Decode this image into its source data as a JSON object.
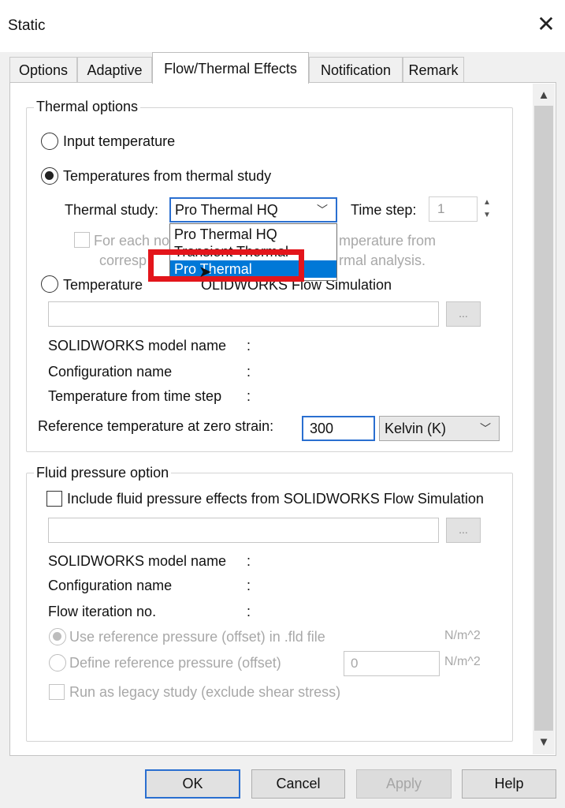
{
  "window": {
    "title": "Static",
    "close_icon": "close-icon"
  },
  "tabs": [
    "Options",
    "Adaptive",
    "Flow/Thermal Effects",
    "Notification",
    "Remark"
  ],
  "active_tab": "Flow/Thermal Effects",
  "thermal": {
    "group_label": "Thermal options",
    "radio_input_temperature": "Input temperature",
    "radio_from_thermal_study": "Temperatures from thermal study",
    "thermal_study_label": "Thermal study:",
    "thermal_study_value": "Pro Thermal HQ",
    "time_step_label": "Time step:",
    "time_step_value": "1",
    "dropdown_items": [
      "Pro Thermal HQ",
      "Transient Thermal",
      "Pro Thermal"
    ],
    "dropdown_selected": "Pro Thermal",
    "hidden_checkbox_text_start": "For each no",
    "hidden_checkbox_text_end": "mperature from",
    "hidden_line2_start": "corresp",
    "hidden_line2_end": "rmal analysis.",
    "radio_flow_sim_start": "Temperature ",
    "radio_flow_sim_end": "OLIDWORKS Flow Simulation",
    "browse_label": "...",
    "model_name_label": "SOLIDWORKS model name",
    "config_name_label": "Configuration name",
    "temp_time_step_label": "Temperature from time step",
    "colon": ":",
    "ref_temp_label": "Reference temperature at zero strain:",
    "ref_temp_value": "300",
    "unit_value": "Kelvin (K)"
  },
  "fluid": {
    "group_label": "Fluid pressure option",
    "include_checkbox": "Include fluid pressure effects from SOLIDWORKS Flow Simulation",
    "browse_label": "...",
    "model_name_label": "SOLIDWORKS model name",
    "config_name_label": "Configuration name",
    "flow_iter_label": "Flow iteration no.",
    "colon": ":",
    "use_ref_pressure": "Use reference pressure (offset) in .fld file",
    "define_ref_pressure": "Define reference pressure (offset)",
    "ref_pressure_value": "0",
    "unit": "N/m^2",
    "legacy_checkbox": "Run as legacy study (exclude shear stress)"
  },
  "buttons": {
    "ok": "OK",
    "cancel": "Cancel",
    "apply": "Apply",
    "help": "Help"
  },
  "colors": {
    "highlight": "#0078d7",
    "annotation_box": "#e3151b",
    "focus": "#2a6fd0"
  }
}
